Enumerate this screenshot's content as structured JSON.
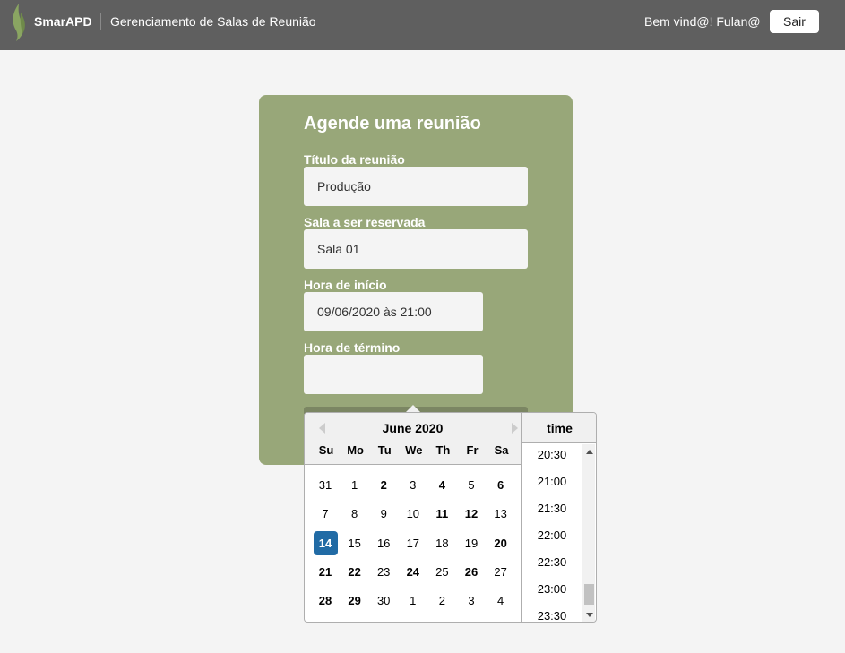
{
  "header": {
    "brand": "SmarAPD",
    "app_title": "Gerenciamento de Salas de Reunião",
    "welcome": "Bem vind@! Fulan@",
    "logout_label": "Sair"
  },
  "form": {
    "title": "Agende uma reunião",
    "meeting_title_label": "Título da reunião",
    "meeting_title_value": "Produção",
    "room_label": "Sala a ser reservada",
    "room_value": "Sala 01",
    "start_label": "Hora de início",
    "start_value": "09/06/2020 às 21:00",
    "end_label": "Hora de término",
    "end_value": ""
  },
  "datepicker": {
    "month_label": "June 2020",
    "weekdays": [
      "Su",
      "Mo",
      "Tu",
      "We",
      "Th",
      "Fr",
      "Sa"
    ],
    "weeks": [
      [
        "31",
        "1",
        "2",
        "3",
        "4",
        "5",
        "6"
      ],
      [
        "7",
        "8",
        "9",
        "10",
        "11",
        "12",
        "13"
      ],
      [
        "14",
        "15",
        "16",
        "17",
        "18",
        "19",
        "20"
      ],
      [
        "21",
        "22",
        "23",
        "24",
        "25",
        "26",
        "27"
      ],
      [
        "28",
        "29",
        "30",
        "1",
        "2",
        "3",
        "4"
      ]
    ],
    "selected_day": "14",
    "time_header": "time",
    "times": [
      "20:30",
      "21:00",
      "21:30",
      "22:00",
      "22:30",
      "23:00",
      "23:30"
    ]
  },
  "colors": {
    "header_bg": "#5f5f5f",
    "card_bg": "#98a779",
    "selected_day_bg": "#216ba5",
    "page_bg": "#f4f4f4"
  }
}
